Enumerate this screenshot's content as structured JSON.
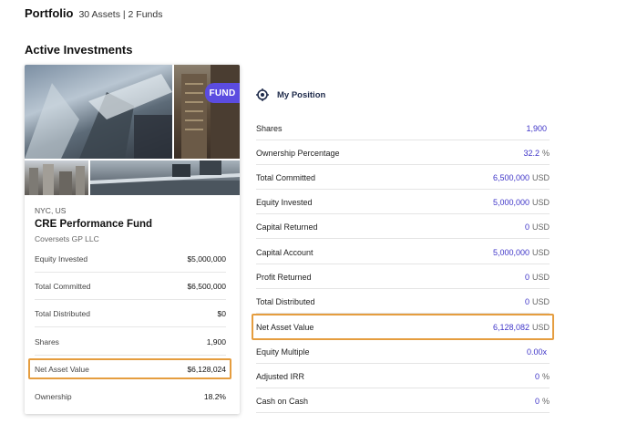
{
  "header": {
    "title": "Portfolio",
    "subtitle": "30 Assets | 2 Funds"
  },
  "section": {
    "title": "Active Investments"
  },
  "card": {
    "badge": "FUND",
    "location": "NYC, US",
    "name": "CRE Performance Fund",
    "gp": "Coversets GP LLC",
    "rows": [
      {
        "label": "Equity Invested",
        "value": "$5,000,000"
      },
      {
        "label": "Total Committed",
        "value": "$6,500,000"
      },
      {
        "label": "Total Distributed",
        "value": "$0"
      },
      {
        "label": "Shares",
        "value": "1,900"
      },
      {
        "label": "Net Asset Value",
        "value": "$6,128,024"
      },
      {
        "label": "Ownership",
        "value": "18.2%"
      }
    ]
  },
  "position": {
    "title": "My Position",
    "icon": "target-icon",
    "rows": [
      {
        "label": "Shares",
        "value": "1,900",
        "unit": ""
      },
      {
        "label": "Ownership Percentage",
        "value": "32.2",
        "unit": "%"
      },
      {
        "label": "Total Committed",
        "value": "6,500,000",
        "unit": "USD"
      },
      {
        "label": "Equity Invested",
        "value": "5,000,000",
        "unit": "USD"
      },
      {
        "label": "Capital Returned",
        "value": "0",
        "unit": "USD"
      },
      {
        "label": "Capital Account",
        "value": "5,000,000",
        "unit": "USD"
      },
      {
        "label": "Profit Returned",
        "value": "0",
        "unit": "USD"
      },
      {
        "label": "Total Distributed",
        "value": "0",
        "unit": "USD"
      },
      {
        "label": "Net Asset Value",
        "value": "6,128,082",
        "unit": "USD"
      },
      {
        "label": "Equity Multiple",
        "value": "0.00x",
        "unit": ""
      },
      {
        "label": "Adjusted IRR",
        "value": "0",
        "unit": "%"
      },
      {
        "label": "Cash on Cash",
        "value": "0",
        "unit": "%"
      }
    ]
  },
  "colors": {
    "accent": "#3f35c8",
    "badge": "#5b4ce0",
    "highlight": "#e59d3f"
  }
}
